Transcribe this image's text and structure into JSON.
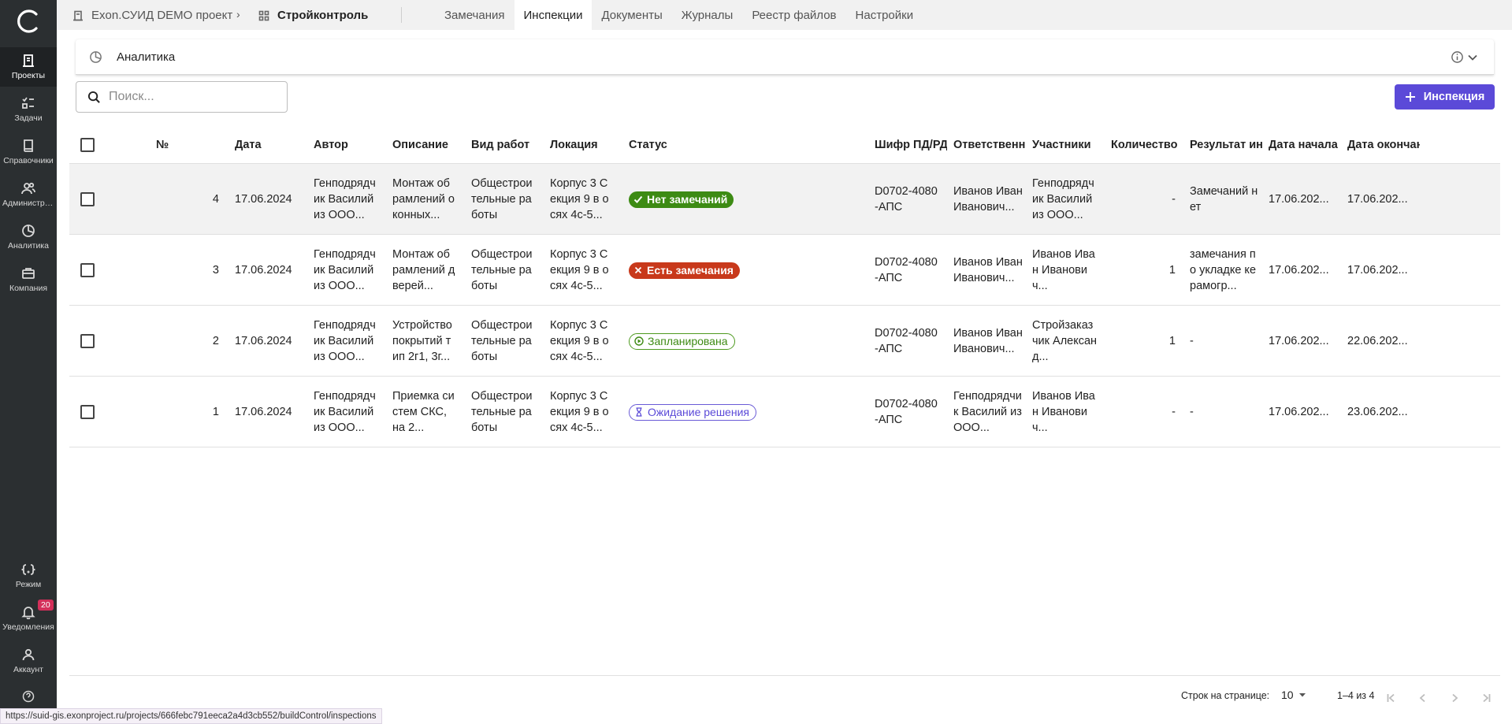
{
  "sidebar": {
    "items": [
      {
        "label": "Проекты",
        "icon": "building-icon"
      },
      {
        "label": "Задачи",
        "icon": "tasks-icon"
      },
      {
        "label": "Справочники",
        "icon": "book-icon"
      },
      {
        "label": "Администрирование",
        "icon": "users-icon"
      },
      {
        "label": "Аналитика",
        "icon": "pie-chart-icon"
      },
      {
        "label": "Компания",
        "icon": "briefcase-icon"
      }
    ],
    "bottom": [
      {
        "label": "Режим",
        "icon": "code-braces-icon"
      },
      {
        "label": "Уведомления",
        "icon": "bell-icon",
        "badge": "20"
      },
      {
        "label": "Аккаунт",
        "icon": "person-icon"
      }
    ]
  },
  "topbar": {
    "project": "Exon.СУИД DEMO проект",
    "module": "Стройконтроль",
    "tabs": [
      "Замечания",
      "Инспекции",
      "Документы",
      "Журналы",
      "Реестр файлов",
      "Настройки"
    ],
    "active_tab": "Инспекции"
  },
  "analytics": {
    "title": "Аналитика"
  },
  "search": {
    "placeholder": "Поиск..."
  },
  "add_button": {
    "label": "Инспекция"
  },
  "table": {
    "columns": [
      "№",
      "Дата",
      "Автор",
      "Описание",
      "Вид работ",
      "Локация",
      "Статус",
      "Шифр ПД/РД",
      "Ответственный",
      "Участники",
      "Количество замечаний",
      "Результат инспекции",
      "Дата начала",
      "Дата окончания"
    ],
    "rows": [
      {
        "num": "4",
        "date": "17.06.2024",
        "author": "Генподрядчик Василий из ООО...",
        "desc": "Монтаж обрамлений оконных...",
        "work": "Общестроительные работы",
        "loc": "Корпус 3 Секция 9 в осях 4с-5...",
        "status": "Нет замечаний",
        "status_kind": "ok",
        "code": "D0702-4080-АПС",
        "resp": "Иванов Иван Иванович...",
        "part": "Генподрядчик Василий из ООО...",
        "count": "-",
        "result": "Замечаний нет",
        "start": "17.06.202...",
        "end": "17.06.202..."
      },
      {
        "num": "3",
        "date": "17.06.2024",
        "author": "Генподрядчик Василий из ООО...",
        "desc": "Монтаж обрамлений дверей...",
        "work": "Общестроительные работы",
        "loc": "Корпус 3 Секция 9 в осях 4с-5...",
        "status": "Есть замечания",
        "status_kind": "bad",
        "code": "D0702-4080-АПС",
        "resp": "Иванов Иван Иванович...",
        "part": "Иванов Иван Иванович...",
        "count": "1",
        "result": "замечания по укладке керамогр...",
        "start": "17.06.202...",
        "end": "17.06.202..."
      },
      {
        "num": "2",
        "date": "17.06.2024",
        "author": "Генподрядчик Василий из ООО...",
        "desc": "Устройство покрытий тип 2г1, 3г...",
        "work": "Общестроительные работы",
        "loc": "Корпус 3 Секция 9 в осях 4с-5...",
        "status": "Запланирована",
        "status_kind": "plan",
        "code": "D0702-4080-АПС",
        "resp": "Иванов Иван Иванович...",
        "part": "Стройзаказчик Александ...",
        "count": "1",
        "result": "-",
        "start": "17.06.202...",
        "end": "22.06.202..."
      },
      {
        "num": "1",
        "date": "17.06.2024",
        "author": "Генподрядчик Василий из ООО...",
        "desc": "Приемка систем СКС, на 2...",
        "work": "Общестроительные работы",
        "loc": "Корпус 3 Секция 9 в осях 4с-5...",
        "status": "Ожидание решения",
        "status_kind": "wait",
        "code": "D0702-4080-АПС",
        "resp": "Генподрядчик Василий из ООО...",
        "part": "Иванов Иван Иванович...",
        "count": "-",
        "result": "-",
        "start": "17.06.202...",
        "end": "23.06.202..."
      }
    ]
  },
  "pagination": {
    "rows_label": "Строк на странице:",
    "rows_value": "10",
    "range": "1–4 из 4"
  },
  "statusbar": {
    "url": "https://suid-gis.exonproject.ru/projects/666febc791eeca2a4d3cb552/buildControl/inspections"
  },
  "colors": {
    "sidebar": "#2b2f31",
    "accent": "#5b4ad8",
    "ok": "#3d8b14",
    "bad": "#c8391b"
  }
}
